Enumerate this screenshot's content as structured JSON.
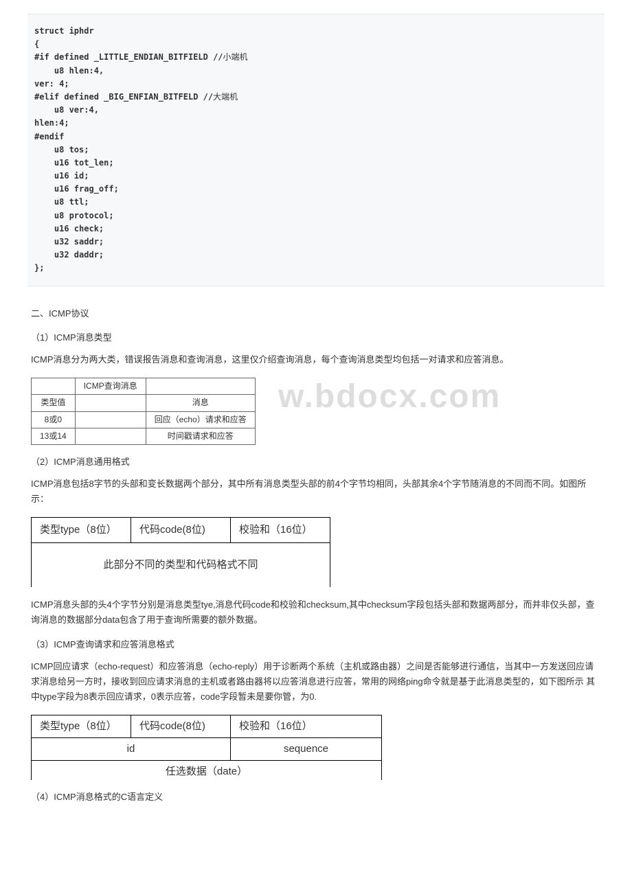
{
  "code": {
    "l1": "struct iphdr",
    "l2": "{",
    "l3": "#if defined _LITTLE_ENDIAN_BITFIELD //",
    "l3cn": "小端机",
    "l4": "    u8 hlen:4,",
    "l5": "ver: 4;",
    "l6": "#elif defined _BIG_ENFIAN_BITFELD //",
    "l6cn": "大端机",
    "l7": "    u8 ver:4,",
    "l8": "hlen:4;",
    "l9": "#endif",
    "l10": "",
    "l11": "    u8 tos;",
    "l12": "    u16 tot_len;",
    "l13": "    u16 id;",
    "l14": "    u16 frag_off;",
    "l15": "    u8 ttl;",
    "l16": "    u8 protocol;",
    "l17": "    u16 check;",
    "l18": "    u32 saddr;",
    "l19": "    u32 daddr;",
    "l20": "};"
  },
  "section2_title": "二、ICMP协议",
  "sub1_title": "（1）ICMP消息类型",
  "sub1_para": "ICMP消息分为两大类，错误报告消息和查询消息，这里仅介绍查询消息，每个查询消息类型均包括一对请求和应答消息。",
  "query_table": {
    "h1": "ICMP查询消息",
    "r1c1": "类型值",
    "r1c2": "消息",
    "r2c1": "8或0",
    "r2c2": "回应（echo）请求和应答",
    "r3c1": "13或14",
    "r3c2": "时间戳请求和应答"
  },
  "watermark": "w.bdocx.com",
  "sub2_title": "（2）ICMP消息通用格式",
  "sub2_para": "ICMP消息包括8字节的头部和变长数据两个部分，其中所有消息类型头部的前4个字节均相同，头部其余4个字节随消息的不同而不同。如图所示：",
  "fmt_table": {
    "c1": "类型type（8位）",
    "c2": "代码code(8位)",
    "c3": "校验和（16位）",
    "row2": "此部分不同的类型和代码格式不同"
  },
  "sub2_para2": "ICMP消息头部的头4个字节分别是消息类型tye,消息代码code和校验和checksum,其中checksum字段包括头部和数据两部分，而并非仅头部，查询消息的数据部分data包含了用于查询所需要的额外数据。",
  "sub3_title": "（3）ICMP查询请求和应答消息格式",
  "sub3_para": "ICMP回应请求（echo-request）和应答消息（echo-reply）用于诊断两个系统（主机或路由器）之间是否能够进行通信，当其中一方发送回应请求消息给另一方时，接收到回应请求消息的主机或者路由器将以应答消息进行应答，常用的网络ping命令就是基于此消息类型的，如下图所示 其中type字段为8表示回应请求，0表示应答，code字段暂未是要你管，为0.",
  "fmt_table2": {
    "c1": "类型type（8位）",
    "c2": "代码code(8位)",
    "c3": "校验和（16位）",
    "r2c1": "id",
    "r2c2": "sequence",
    "r3": "任选数据（date）",
    "sub": ""
  },
  "sub4_title": "（4）ICMP消息格式的C语言定义"
}
